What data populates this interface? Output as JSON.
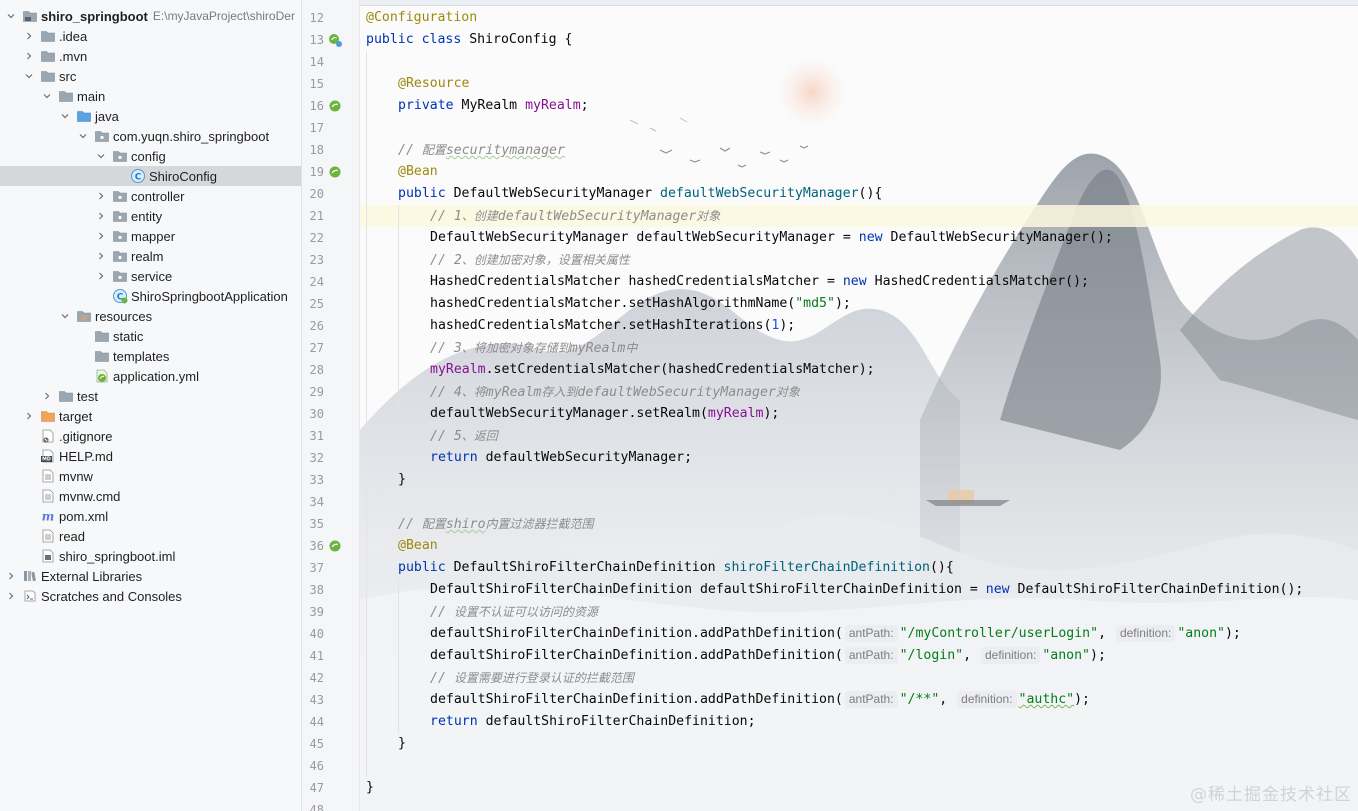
{
  "project_tree": {
    "items": [
      {
        "label": "shiro_springboot",
        "path": "E:\\myJavaProject\\shiroDer",
        "icon": "module-folder-icon",
        "depth": 0,
        "expand": "open",
        "bold": true
      },
      {
        "label": ".idea",
        "icon": "folder-icon",
        "depth": 1,
        "expand": "closed"
      },
      {
        "label": ".mvn",
        "icon": "folder-icon",
        "depth": 1,
        "expand": "closed"
      },
      {
        "label": "src",
        "icon": "folder-icon",
        "depth": 1,
        "expand": "open"
      },
      {
        "label": "main",
        "icon": "folder-icon",
        "depth": 2,
        "expand": "open"
      },
      {
        "label": "java",
        "icon": "source-folder-icon",
        "depth": 3,
        "expand": "open"
      },
      {
        "label": "com.yuqn.shiro_springboot",
        "icon": "package-icon",
        "depth": 4,
        "expand": "open"
      },
      {
        "label": "config",
        "icon": "package-icon",
        "depth": 5,
        "expand": "open"
      },
      {
        "label": "ShiroConfig",
        "icon": "java-class-icon",
        "depth": 6,
        "expand": "none",
        "selected": true
      },
      {
        "label": "controller",
        "icon": "package-icon",
        "depth": 5,
        "expand": "closed"
      },
      {
        "label": "entity",
        "icon": "package-icon",
        "depth": 5,
        "expand": "closed"
      },
      {
        "label": "mapper",
        "icon": "package-icon",
        "depth": 5,
        "expand": "closed"
      },
      {
        "label": "realm",
        "icon": "package-icon",
        "depth": 5,
        "expand": "closed"
      },
      {
        "label": "service",
        "icon": "package-icon",
        "depth": 5,
        "expand": "closed"
      },
      {
        "label": "ShiroSpringbootApplication",
        "icon": "spring-boot-class-icon",
        "depth": 5,
        "expand": "none"
      },
      {
        "label": "resources",
        "icon": "resources-folder-icon",
        "depth": 3,
        "expand": "open"
      },
      {
        "label": "static",
        "icon": "folder-icon",
        "depth": 4,
        "expand": "none"
      },
      {
        "label": "templates",
        "icon": "folder-icon",
        "depth": 4,
        "expand": "none"
      },
      {
        "label": "application.yml",
        "icon": "spring-yml-icon",
        "depth": 4,
        "expand": "none"
      },
      {
        "label": "test",
        "icon": "folder-icon",
        "depth": 2,
        "expand": "closed"
      },
      {
        "label": "target",
        "icon": "excluded-folder-icon",
        "depth": 1,
        "expand": "closed"
      },
      {
        "label": ".gitignore",
        "icon": "gitignore-file-icon",
        "depth": 1,
        "expand": "none"
      },
      {
        "label": "HELP.md",
        "icon": "markdown-file-icon",
        "depth": 1,
        "expand": "none"
      },
      {
        "label": "mvnw",
        "icon": "text-file-icon",
        "depth": 1,
        "expand": "none"
      },
      {
        "label": "mvnw.cmd",
        "icon": "text-file-icon",
        "depth": 1,
        "expand": "none"
      },
      {
        "label": "pom.xml",
        "icon": "maven-file-icon",
        "depth": 1,
        "expand": "none"
      },
      {
        "label": "read",
        "icon": "text-file-icon",
        "depth": 1,
        "expand": "none"
      },
      {
        "label": "shiro_springboot.iml",
        "icon": "iml-file-icon",
        "depth": 1,
        "expand": "none"
      },
      {
        "label": "External Libraries",
        "icon": "libraries-icon",
        "depth": 0,
        "expand": "closed"
      },
      {
        "label": "Scratches and Consoles",
        "icon": "scratches-icon",
        "depth": 0,
        "expand": "closed"
      }
    ]
  },
  "editor": {
    "current_line": 21,
    "lines": [
      {
        "n": 12,
        "indent": 0,
        "tokens": [
          [
            "ann",
            "@Configuration"
          ]
        ]
      },
      {
        "n": 13,
        "indent": 0,
        "gutter_icon": "spring-config-gutter-icon",
        "tokens": [
          [
            "kw",
            "public class "
          ],
          [
            "plain",
            "ShiroConfig {"
          ]
        ]
      },
      {
        "n": 14,
        "indent": 0,
        "tokens": []
      },
      {
        "n": 15,
        "indent": 1,
        "tokens": [
          [
            "ann",
            "@Resource"
          ]
        ]
      },
      {
        "n": 16,
        "indent": 1,
        "gutter_icon": "spring-bean-gutter-icon",
        "tokens": [
          [
            "kw",
            "private "
          ],
          [
            "plain",
            "MyRealm "
          ],
          [
            "field",
            "myRealm"
          ],
          [
            "plain",
            ";"
          ]
        ]
      },
      {
        "n": 17,
        "indent": 0,
        "tokens": []
      },
      {
        "n": 18,
        "indent": 1,
        "tokens": [
          [
            "cmt",
            "// "
          ],
          [
            "cn",
            "配置"
          ],
          [
            "cmtu",
            "securitymanager"
          ]
        ]
      },
      {
        "n": 19,
        "indent": 1,
        "gutter_icon": "spring-bean-gutter-icon",
        "tokens": [
          [
            "ann",
            "@Bean"
          ]
        ]
      },
      {
        "n": 20,
        "indent": 1,
        "tokens": [
          [
            "kw",
            "public "
          ],
          [
            "plain",
            "DefaultWebSecurityManager "
          ],
          [
            "fn",
            "defaultWebSecurityManager"
          ],
          [
            "plain",
            "(){"
          ]
        ]
      },
      {
        "n": 21,
        "indent": 2,
        "tokens": [
          [
            "cmt",
            "// 1"
          ],
          [
            "cn",
            "、创建"
          ],
          [
            "cmt",
            "defaultWebSecurityManager"
          ],
          [
            "cn",
            "对象"
          ]
        ]
      },
      {
        "n": 22,
        "indent": 2,
        "tokens": [
          [
            "plain",
            "DefaultWebSecurityManager defaultWebSecurityManager = "
          ],
          [
            "kw",
            "new "
          ],
          [
            "plain",
            "DefaultWebSecurityManager();"
          ]
        ]
      },
      {
        "n": 23,
        "indent": 2,
        "tokens": [
          [
            "cmt",
            "// 2"
          ],
          [
            "cn",
            "、创建加密对象，设置相关属性"
          ]
        ]
      },
      {
        "n": 24,
        "indent": 2,
        "tokens": [
          [
            "plain",
            "HashedCredentialsMatcher hashedCredentialsMatcher = "
          ],
          [
            "kw",
            "new "
          ],
          [
            "plain",
            "HashedCredentialsMatcher();"
          ]
        ]
      },
      {
        "n": 25,
        "indent": 2,
        "tokens": [
          [
            "plain",
            "hashedCredentialsMatcher.setHashAlgorithmName("
          ],
          [
            "str",
            "\"md5\""
          ],
          [
            "plain",
            ");"
          ]
        ]
      },
      {
        "n": 26,
        "indent": 2,
        "tokens": [
          [
            "plain",
            "hashedCredentialsMatcher.setHashIterations("
          ],
          [
            "num",
            "1"
          ],
          [
            "plain",
            ");"
          ]
        ]
      },
      {
        "n": 27,
        "indent": 2,
        "tokens": [
          [
            "cmt",
            "// 3"
          ],
          [
            "cn",
            "、将加密对象存储到"
          ],
          [
            "cmt",
            "myRealm"
          ],
          [
            "cn",
            "中"
          ]
        ]
      },
      {
        "n": 28,
        "indent": 2,
        "tokens": [
          [
            "field",
            "myRealm"
          ],
          [
            "plain",
            ".setCredentialsMatcher(hashedCredentialsMatcher);"
          ]
        ]
      },
      {
        "n": 29,
        "indent": 2,
        "tokens": [
          [
            "cmt",
            "// 4"
          ],
          [
            "cn",
            "、将"
          ],
          [
            "cmt",
            "myRealm"
          ],
          [
            "cn",
            "存入到"
          ],
          [
            "cmt",
            "defaultWebSecurityManager"
          ],
          [
            "cn",
            "对象"
          ]
        ]
      },
      {
        "n": 30,
        "indent": 2,
        "tokens": [
          [
            "plain",
            "defaultWebSecurityManager.setRealm("
          ],
          [
            "field",
            "myRealm"
          ],
          [
            "plain",
            ");"
          ]
        ]
      },
      {
        "n": 31,
        "indent": 2,
        "tokens": [
          [
            "cmt",
            "// 5"
          ],
          [
            "cn",
            "、返回"
          ]
        ]
      },
      {
        "n": 32,
        "indent": 2,
        "tokens": [
          [
            "kw",
            "return "
          ],
          [
            "plain",
            "defaultWebSecurityManager;"
          ]
        ]
      },
      {
        "n": 33,
        "indent": 1,
        "tokens": [
          [
            "plain",
            "}"
          ]
        ]
      },
      {
        "n": 34,
        "indent": 0,
        "tokens": []
      },
      {
        "n": 35,
        "indent": 1,
        "tokens": [
          [
            "cmt",
            "// "
          ],
          [
            "cn",
            "配置"
          ],
          [
            "cmtu",
            "shiro"
          ],
          [
            "cn",
            "内置过滤器拦截范围"
          ]
        ]
      },
      {
        "n": 36,
        "indent": 1,
        "gutter_icon": "spring-bean-gutter-icon",
        "tokens": [
          [
            "ann",
            "@Bean"
          ]
        ]
      },
      {
        "n": 37,
        "indent": 1,
        "tokens": [
          [
            "kw",
            "public "
          ],
          [
            "plain",
            "DefaultShiroFilterChainDefinition "
          ],
          [
            "fn",
            "shiroFilterChainDefinition"
          ],
          [
            "plain",
            "(){"
          ]
        ]
      },
      {
        "n": 38,
        "indent": 2,
        "tokens": [
          [
            "plain",
            "DefaultShiroFilterChainDefinition defaultShiroFilterChainDefinition = "
          ],
          [
            "kw",
            "new "
          ],
          [
            "plain",
            "DefaultShiroFilterChainDefinition();"
          ]
        ]
      },
      {
        "n": 39,
        "indent": 2,
        "tokens": [
          [
            "cmt",
            "// "
          ],
          [
            "cn",
            "设置不认证可以访问的资源"
          ]
        ]
      },
      {
        "n": 40,
        "indent": 2,
        "tokens": [
          [
            "plain",
            "defaultShiroFilterChainDefinition.addPathDefinition("
          ],
          [
            "hint",
            "antPath:"
          ],
          [
            "str",
            "\"/myController/userLogin\""
          ],
          [
            "plain",
            ", "
          ],
          [
            "hint",
            "definition:"
          ],
          [
            "str",
            "\"anon\""
          ],
          [
            "plain",
            ");"
          ]
        ]
      },
      {
        "n": 41,
        "indent": 2,
        "tokens": [
          [
            "plain",
            "defaultShiroFilterChainDefinition.addPathDefinition("
          ],
          [
            "hint",
            "antPath:"
          ],
          [
            "str",
            "\"/login\""
          ],
          [
            "plain",
            ", "
          ],
          [
            "hint",
            "definition:"
          ],
          [
            "str",
            "\"anon\""
          ],
          [
            "plain",
            ");"
          ]
        ]
      },
      {
        "n": 42,
        "indent": 2,
        "tokens": [
          [
            "cmt",
            "// "
          ],
          [
            "cn",
            "设置需要进行登录认证的拦截范围"
          ]
        ]
      },
      {
        "n": 43,
        "indent": 2,
        "tokens": [
          [
            "plain",
            "defaultShiroFilterChainDefinition.addPathDefinition("
          ],
          [
            "hint",
            "antPath:"
          ],
          [
            "str",
            "\"/**\""
          ],
          [
            "plain",
            ", "
          ],
          [
            "hint",
            "definition:"
          ],
          [
            "strtypo",
            "\"authc\""
          ],
          [
            "plain",
            ");"
          ]
        ]
      },
      {
        "n": 44,
        "indent": 2,
        "tokens": [
          [
            "kw",
            "return "
          ],
          [
            "plain",
            "defaultShiroFilterChainDefinition;"
          ]
        ]
      },
      {
        "n": 45,
        "indent": 1,
        "tokens": [
          [
            "plain",
            "}"
          ]
        ]
      },
      {
        "n": 46,
        "indent": 0,
        "tokens": []
      },
      {
        "n": 47,
        "indent": 0,
        "tokens": [
          [
            "plain",
            "}"
          ]
        ]
      },
      {
        "n": 48,
        "indent": 0,
        "tokens": []
      }
    ]
  },
  "watermark": "@稀土掘金技术社区",
  "colors": {
    "keyword": "#0033b3",
    "annotation": "#9e880d",
    "string": "#067d17",
    "number": "#1750eb",
    "field": "#871094",
    "method_decl": "#00627a",
    "comment": "#8c8c8c",
    "selection": "#d5d7db",
    "current_line": "#fcf8de"
  }
}
